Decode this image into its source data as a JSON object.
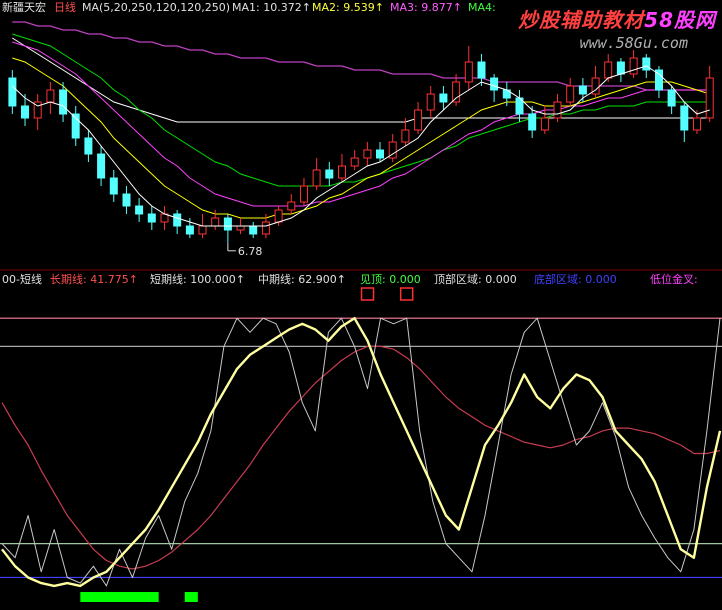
{
  "watermark": {
    "site": "炒股辅助教材",
    "brand": "58股网",
    "url": "www.58Gu.com"
  },
  "header_top": {
    "stock_name": "新疆天宏",
    "period": "日线",
    "ma_def": "MA(5,20,250,120,120,250)",
    "ma1": "MA1: 10.372↑",
    "ma2": "MA2: 9.539↑",
    "ma3": "MA3: 9.877↑",
    "ma4": "MA4:"
  },
  "header_bottom": {
    "indicator": "00-短线",
    "long": "长期线: 41.775↑",
    "short": "短期线: 100.000↑",
    "mid": "中期线: 62.900↑",
    "top": "见顶: 0.000",
    "top_zone": "顶部区域: 0.000",
    "bottom_zone": "底部区域: 0.000",
    "bottom_cross": "低位金叉:"
  },
  "colors": {
    "bg": "#000000",
    "up": "#ff3232",
    "down": "#54ffff",
    "ma_white": "#ffffff",
    "ma_yellow": "#ffff00",
    "ma_purple": "#ff40ff",
    "ma_green": "#00e000",
    "ma_long": "#c040c0",
    "mid_line": "#ffffa0",
    "short_line": "#c8c8c8",
    "long_line": "#c83c50",
    "level_pink": "#ff80a0",
    "level_grey": "#a8a8a8",
    "level_green": "#a0c8a0",
    "level_blue": "#4040ff",
    "marker_red": "#ff3030",
    "bar_green": "#00ff00",
    "text_white": "#e0e0e0",
    "text_red": "#ff5050",
    "text_purple": "#ff60ff",
    "text_green": "#40ff40",
    "text_blue": "#4040ff",
    "text_magenta": "#ff40ff"
  },
  "chart_data": [
    {
      "type": "candlestick",
      "ylim": [
        6.2,
        12.4
      ],
      "low_label": "6.78",
      "candles": [
        [
          10.9,
          10.2,
          11.1,
          10.0
        ],
        [
          10.2,
          9.9,
          10.5,
          9.7
        ],
        [
          9.9,
          10.3,
          10.5,
          9.6
        ],
        [
          10.3,
          10.6,
          10.8,
          10.0
        ],
        [
          10.6,
          10.0,
          10.8,
          9.8
        ],
        [
          10.0,
          9.4,
          10.2,
          9.2
        ],
        [
          9.4,
          9.0,
          9.6,
          8.8
        ],
        [
          9.0,
          8.4,
          9.2,
          8.2
        ],
        [
          8.4,
          8.0,
          8.6,
          7.8
        ],
        [
          8.0,
          7.7,
          8.2,
          7.5
        ],
        [
          7.7,
          7.5,
          7.9,
          7.3
        ],
        [
          7.5,
          7.3,
          7.7,
          7.1
        ],
        [
          7.3,
          7.5,
          7.7,
          7.1
        ],
        [
          7.5,
          7.2,
          7.6,
          7.0
        ],
        [
          7.2,
          7.0,
          7.4,
          6.9
        ],
        [
          7.0,
          7.2,
          7.5,
          6.9
        ],
        [
          7.2,
          7.4,
          7.6,
          7.1
        ],
        [
          7.4,
          7.1,
          7.5,
          6.78
        ],
        [
          7.1,
          7.2,
          7.4,
          7.0
        ],
        [
          7.2,
          7.0,
          7.3,
          6.9
        ],
        [
          7.0,
          7.3,
          7.5,
          6.9
        ],
        [
          7.3,
          7.6,
          7.7,
          7.2
        ],
        [
          7.6,
          7.8,
          8.0,
          7.5
        ],
        [
          7.8,
          8.2,
          8.4,
          7.7
        ],
        [
          8.2,
          8.6,
          8.9,
          8.1
        ],
        [
          8.6,
          8.4,
          8.8,
          8.2
        ],
        [
          8.4,
          8.7,
          9.0,
          8.3
        ],
        [
          8.7,
          8.9,
          9.1,
          8.6
        ],
        [
          8.9,
          9.1,
          9.3,
          8.7
        ],
        [
          9.1,
          8.9,
          9.3,
          8.8
        ],
        [
          8.9,
          9.3,
          9.5,
          8.8
        ],
        [
          9.3,
          9.6,
          9.9,
          9.2
        ],
        [
          9.6,
          10.1,
          10.3,
          9.5
        ],
        [
          10.1,
          10.5,
          10.7,
          9.9
        ],
        [
          10.5,
          10.3,
          10.7,
          10.1
        ],
        [
          10.3,
          10.8,
          11.0,
          10.2
        ],
        [
          10.8,
          11.3,
          11.7,
          10.6
        ],
        [
          11.3,
          10.9,
          11.5,
          10.7
        ],
        [
          10.9,
          10.6,
          11.0,
          10.3
        ],
        [
          10.6,
          10.4,
          10.8,
          10.2
        ],
        [
          10.4,
          10.0,
          10.6,
          9.8
        ],
        [
          10.0,
          9.6,
          10.2,
          9.4
        ],
        [
          9.6,
          9.9,
          10.2,
          9.5
        ],
        [
          9.9,
          10.3,
          10.5,
          9.8
        ],
        [
          10.3,
          10.7,
          10.9,
          10.2
        ],
        [
          10.7,
          10.5,
          10.9,
          10.3
        ],
        [
          10.5,
          10.9,
          11.2,
          10.4
        ],
        [
          10.9,
          11.3,
          11.5,
          10.8
        ],
        [
          11.3,
          11.0,
          11.4,
          10.8
        ],
        [
          11.0,
          11.4,
          11.6,
          10.9
        ],
        [
          11.4,
          11.1,
          11.5,
          10.9
        ],
        [
          11.1,
          10.6,
          11.2,
          10.4
        ],
        [
          10.6,
          10.2,
          10.7,
          10.0
        ],
        [
          10.2,
          9.6,
          10.3,
          9.3
        ],
        [
          9.6,
          9.9,
          10.1,
          9.5
        ],
        [
          9.9,
          10.9,
          11.2,
          9.8
        ]
      ],
      "ma_white_fast": [
        10.7,
        10.4,
        10.2,
        10.3,
        10.2,
        9.9,
        9.6,
        9.2,
        8.8,
        8.4,
        8.0,
        7.7,
        7.5,
        7.4,
        7.3,
        7.2,
        7.2,
        7.2,
        7.2,
        7.2,
        7.2,
        7.3,
        7.4,
        7.6,
        7.9,
        8.1,
        8.3,
        8.5,
        8.7,
        8.8,
        9.0,
        9.2,
        9.4,
        9.8,
        10.1,
        10.4,
        10.6,
        10.8,
        10.7,
        10.6,
        10.4,
        10.1,
        10.0,
        10.0,
        10.1,
        10.4,
        10.6,
        10.9,
        11.0,
        11.1,
        11.2,
        11.0,
        10.7,
        10.3,
        10.0,
        10.1
      ],
      "ma_yellow": [
        11.4,
        11.3,
        11.1,
        10.9,
        10.7,
        10.4,
        10.1,
        9.8,
        9.4,
        9.1,
        8.8,
        8.5,
        8.2,
        8.0,
        7.8,
        7.6,
        7.5,
        7.5,
        7.4,
        7.4,
        7.4,
        7.5,
        7.5,
        7.6,
        7.7,
        7.9,
        8.0,
        8.2,
        8.4,
        8.5,
        8.7,
        8.9,
        9.1,
        9.3,
        9.5,
        9.7,
        9.9,
        10.1,
        10.2,
        10.3,
        10.3,
        10.3,
        10.2,
        10.2,
        10.2,
        10.3,
        10.4,
        10.5,
        10.6,
        10.7,
        10.8,
        10.8,
        10.8,
        10.7,
        10.6,
        10.5
      ],
      "ma_purple": [
        11.8,
        11.7,
        11.6,
        11.4,
        11.2,
        11.0,
        10.7,
        10.4,
        10.1,
        9.8,
        9.5,
        9.2,
        8.9,
        8.7,
        8.4,
        8.2,
        8.0,
        7.9,
        7.8,
        7.7,
        7.7,
        7.7,
        7.7,
        7.7,
        7.8,
        7.8,
        7.9,
        8.0,
        8.1,
        8.2,
        8.4,
        8.5,
        8.7,
        8.9,
        9.1,
        9.3,
        9.5,
        9.6,
        9.8,
        9.9,
        10.0,
        10.0,
        10.1,
        10.1,
        10.2,
        10.2,
        10.3,
        10.4,
        10.4,
        10.5,
        10.6,
        10.6,
        10.6,
        10.6,
        10.6,
        10.6
      ],
      "ma_green": [
        12.0,
        11.9,
        11.8,
        11.7,
        11.5,
        11.3,
        11.1,
        10.9,
        10.6,
        10.4,
        10.1,
        9.9,
        9.6,
        9.4,
        9.2,
        9.0,
        8.8,
        8.7,
        8.5,
        8.4,
        8.3,
        8.2,
        8.2,
        8.2,
        8.2,
        8.2,
        8.3,
        8.3,
        8.4,
        8.5,
        8.6,
        8.7,
        8.8,
        8.9,
        9.1,
        9.2,
        9.4,
        9.5,
        9.6,
        9.7,
        9.8,
        9.9,
        9.9,
        10.0,
        10.0,
        10.1,
        10.1,
        10.2,
        10.2,
        10.2,
        10.3,
        10.3,
        10.3,
        10.3,
        10.3,
        10.3
      ],
      "ma_long": [
        12.3,
        12.3,
        12.2,
        12.2,
        12.1,
        12.1,
        12.0,
        12.0,
        11.9,
        11.9,
        11.8,
        11.8,
        11.7,
        11.7,
        11.6,
        11.6,
        11.5,
        11.5,
        11.4,
        11.4,
        11.4,
        11.3,
        11.3,
        11.3,
        11.2,
        11.2,
        11.2,
        11.1,
        11.1,
        11.1,
        11.0,
        11.0,
        11.0,
        11.0,
        10.9,
        10.9,
        10.9,
        10.9,
        10.8,
        10.8,
        10.8,
        10.8,
        10.8,
        10.8,
        10.7,
        10.7,
        10.7,
        10.7,
        10.7,
        10.7,
        10.6,
        10.6,
        10.6,
        10.6,
        10.6,
        10.6
      ],
      "ma_white_slow": [
        11.9,
        11.7,
        11.5,
        11.3,
        11.1,
        10.9,
        10.7,
        10.5,
        10.3,
        10.2,
        10.1,
        10.0,
        9.9,
        9.8,
        9.8,
        9.8,
        9.8,
        9.8,
        9.8,
        9.8,
        9.8,
        9.8,
        9.8,
        9.8,
        9.8,
        9.8,
        9.8,
        9.8,
        9.8,
        9.8,
        9.8,
        9.8,
        9.9,
        9.9,
        9.9,
        9.9,
        9.9,
        9.9,
        9.9,
        9.9,
        9.9,
        9.9,
        9.9,
        9.9,
        9.9,
        9.9,
        9.9,
        9.9,
        9.9,
        9.9,
        9.9,
        9.9,
        9.9,
        9.9,
        9.9,
        9.9
      ]
    },
    {
      "type": "line",
      "ylim": [
        0,
        110
      ],
      "levels": {
        "top": 100,
        "upper": 90,
        "lower": 20,
        "bottom": 8
      },
      "short": [
        20,
        15,
        30,
        10,
        25,
        8,
        6,
        12,
        5,
        18,
        8,
        22,
        30,
        18,
        35,
        45,
        60,
        90,
        100,
        95,
        100,
        98,
        88,
        70,
        60,
        95,
        100,
        90,
        75,
        100,
        98,
        100,
        60,
        35,
        20,
        15,
        10,
        30,
        55,
        80,
        95,
        100,
        85,
        70,
        55,
        60,
        70,
        58,
        40,
        30,
        22,
        15,
        10,
        25,
        60,
        100
      ],
      "mid": [
        18,
        12,
        8,
        6,
        5,
        6,
        5,
        8,
        10,
        15,
        20,
        25,
        32,
        40,
        48,
        56,
        66,
        74,
        82,
        87,
        90,
        93,
        96,
        98,
        96,
        92,
        97,
        100,
        92,
        80,
        70,
        60,
        50,
        40,
        30,
        25,
        40,
        55,
        62,
        70,
        80,
        72,
        68,
        75,
        80,
        78,
        72,
        60,
        55,
        50,
        42,
        30,
        18,
        15,
        40,
        60
      ],
      "long": [
        70,
        62,
        55,
        46,
        38,
        30,
        24,
        18,
        14,
        12,
        11,
        12,
        14,
        17,
        21,
        25,
        30,
        36,
        42,
        48,
        55,
        61,
        67,
        72,
        77,
        81,
        85,
        88,
        90,
        90,
        89,
        86,
        82,
        77,
        72,
        68,
        65,
        62,
        60,
        58,
        56,
        55,
        54,
        55,
        57,
        58,
        60,
        61,
        61,
        60,
        59,
        57,
        55,
        52,
        52,
        53
      ],
      "top_markers": [
        28,
        31
      ],
      "bottom_bars": [
        [
          6,
          12
        ],
        [
          14,
          15
        ]
      ]
    }
  ]
}
